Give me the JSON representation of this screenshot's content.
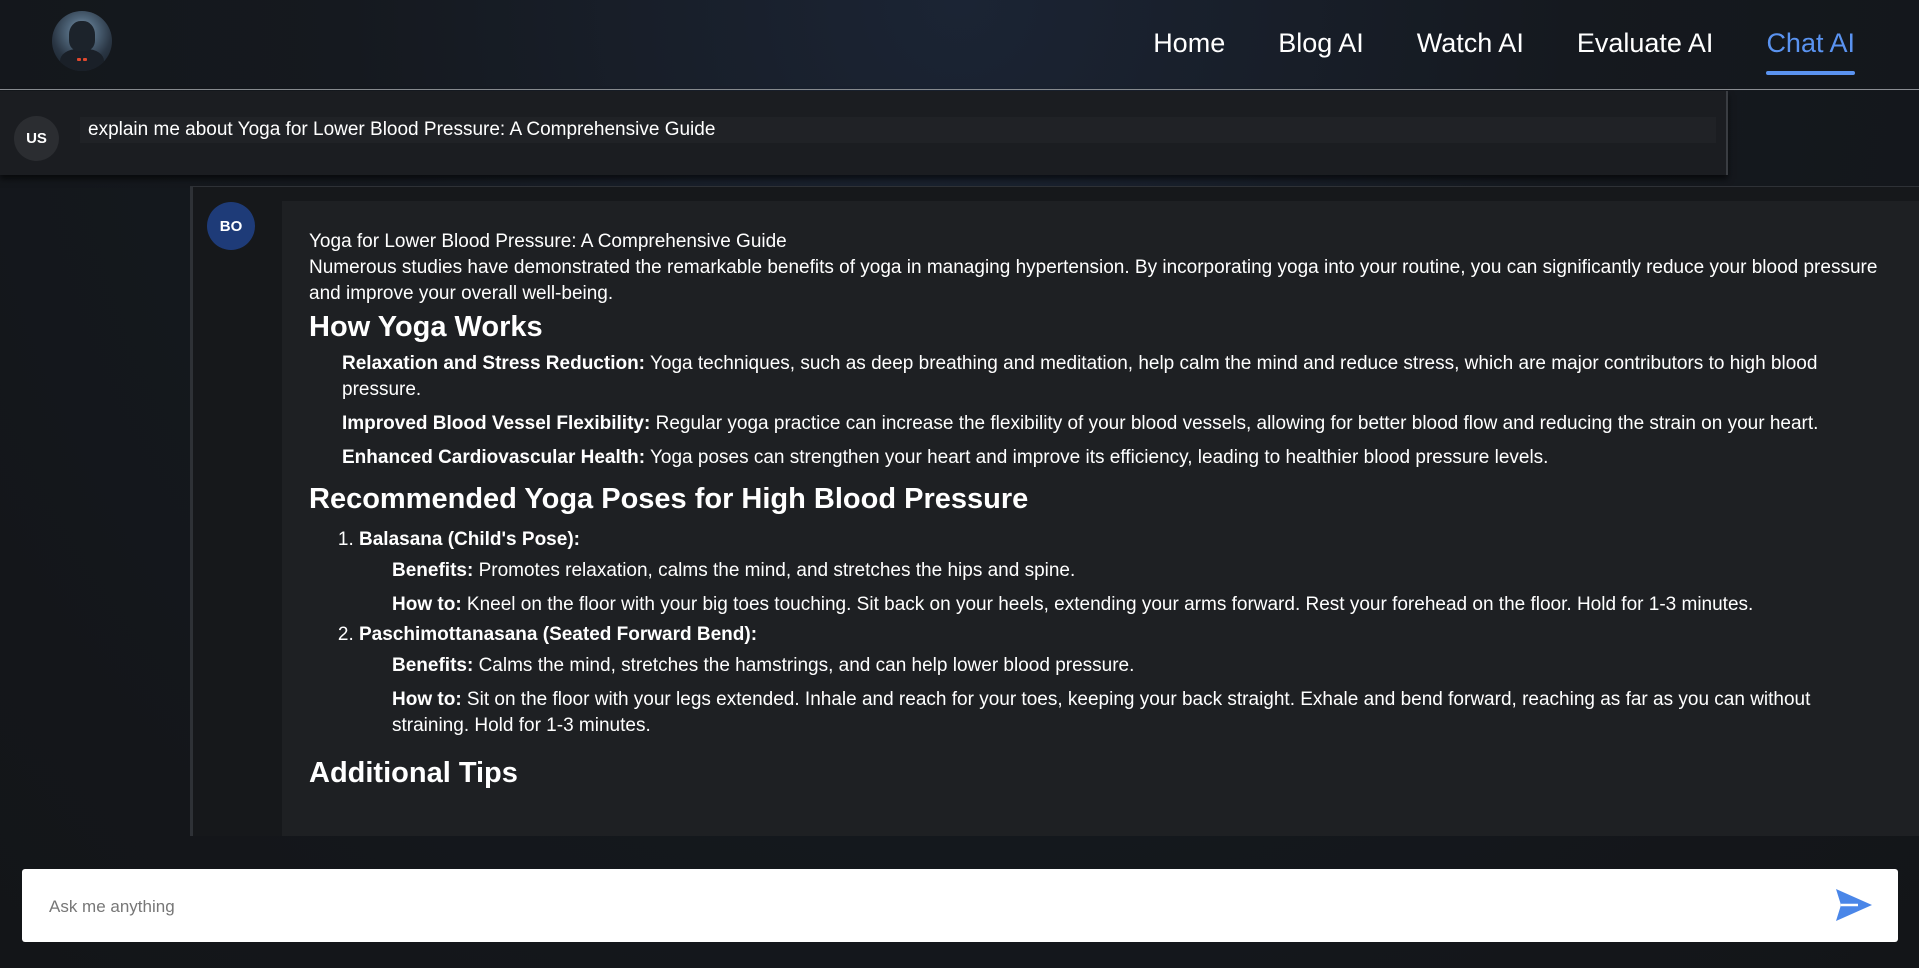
{
  "header": {
    "nav": {
      "home": "Home",
      "blog": "Blog AI",
      "watch": "Watch AI",
      "evaluate": "Evaluate AI",
      "chat": "Chat AI"
    },
    "active_color": "#5a93f0"
  },
  "user_message": {
    "badge": "US",
    "text": "explain me about Yoga for Lower Blood Pressure: A Comprehensive Guide"
  },
  "bot_message": {
    "badge": "BO",
    "title": "Yoga for Lower Blood Pressure: A Comprehensive Guide",
    "intro": "Numerous studies have demonstrated the remarkable benefits of yoga in managing hypertension. By incorporating yoga into your routine, you can significantly reduce your blood pressure and improve your overall well-being.",
    "section1": {
      "heading": "How Yoga Works",
      "items": [
        {
          "label": "Relaxation and Stress Reduction:",
          "text": " Yoga techniques, such as deep breathing and meditation, help calm the mind and reduce stress, which are major contributors to high blood pressure."
        },
        {
          "label": "Improved Blood Vessel Flexibility:",
          "text": " Regular yoga practice can increase the flexibility of your blood vessels, allowing for better blood flow and reducing the strain on your heart."
        },
        {
          "label": "Enhanced Cardiovascular Health:",
          "text": " Yoga poses can strengthen your heart and improve its efficiency, leading to healthier blood pressure levels."
        }
      ]
    },
    "section2": {
      "heading": "Recommended Yoga Poses for High Blood Pressure",
      "poses": [
        {
          "name": "Balasana (Child's Pose):",
          "benefits_label": "Benefits:",
          "benefits": " Promotes relaxation, calms the mind, and stretches the hips and spine.",
          "howto_label": "How to:",
          "howto": " Kneel on the floor with your big toes touching. Sit back on your heels, extending your arms forward. Rest your forehead on the floor. Hold for 1-3 minutes."
        },
        {
          "name": "Paschimottanasana (Seated Forward Bend):",
          "benefits_label": "Benefits:",
          "benefits": " Calms the mind, stretches the hamstrings, and can help lower blood pressure.",
          "howto_label": "How to:",
          "howto": " Sit on the floor with your legs extended. Inhale and reach for your toes, keeping your back straight. Exhale and bend forward, reaching as far as you can without straining. Hold for 1-3 minutes."
        }
      ]
    },
    "section3": {
      "heading": "Additional Tips"
    }
  },
  "input": {
    "placeholder": "Ask me anything",
    "value": ""
  },
  "icons": {
    "send": "send-icon",
    "logo": "robot-avatar-icon"
  }
}
